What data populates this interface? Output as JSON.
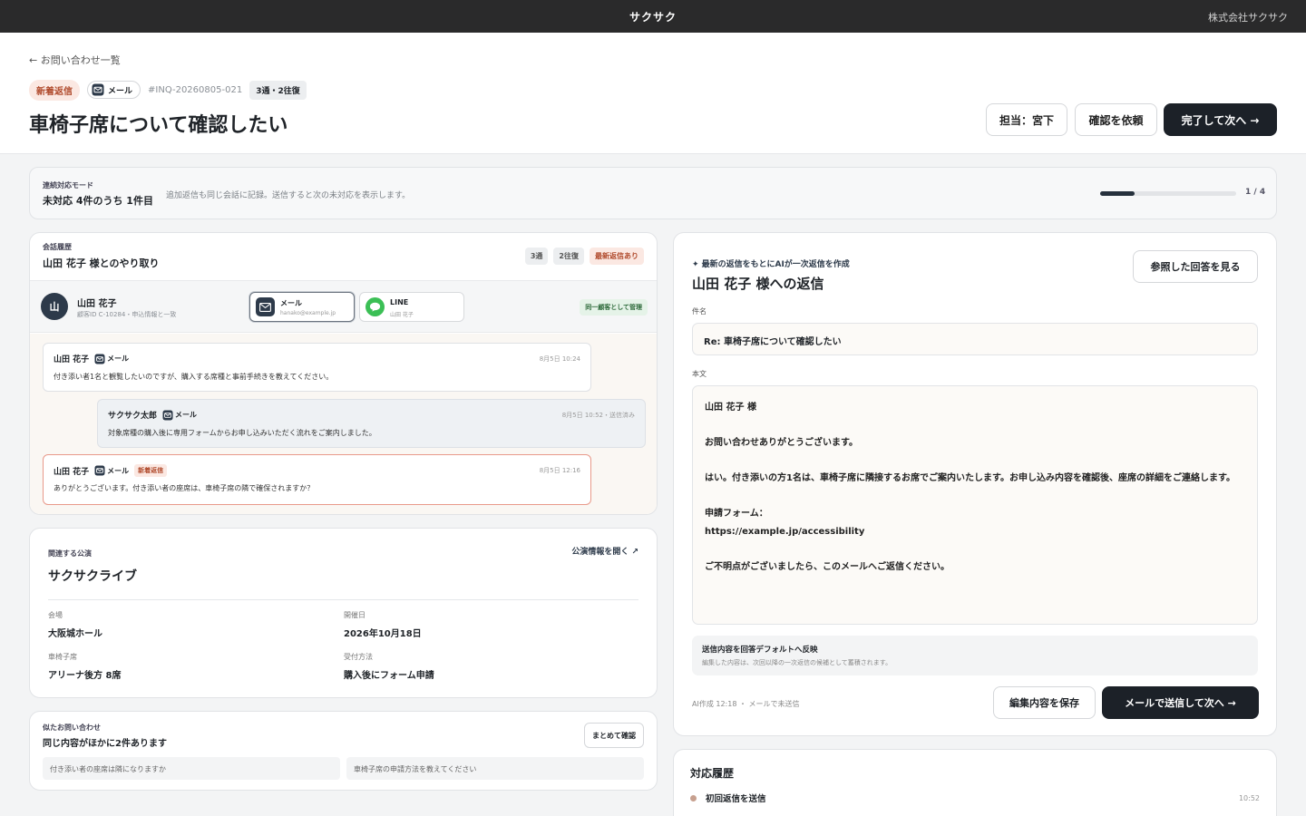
{
  "topbar": {
    "brand": "サクサク",
    "company": "株式会社サクサク"
  },
  "header": {
    "back": "← お問い合わせ一覧",
    "tag_new": "新着返信",
    "tag_channel": "メール",
    "inquiry_id": "#INQ-20260805-021",
    "thread_count": "3通・2往復",
    "title": "車椅子席について確認したい",
    "assignee_btn": "担当：宮下",
    "request_btn": "確認を依頼",
    "complete_btn": "完了して次へ →"
  },
  "mode": {
    "label": "連続対応モード",
    "value": "未対応 4件のうち 1件目",
    "description": "追加返信も同じ会話に記録。送信すると次の未対応を表示します。",
    "progress": 0.25,
    "page": "1 / 4"
  },
  "conversation": {
    "label": "会話履歴",
    "title": "山田 花子 様とのやり取り",
    "pills": [
      "3通",
      "2往復",
      "最新返信あり"
    ],
    "customer": {
      "avatar": "山",
      "name": "山田 花子",
      "sub": "顧客ID C-10284・申込情報と一致",
      "channels": [
        {
          "name": "メール",
          "sub": "hanako@example.jp"
        },
        {
          "name": "LINE",
          "sub": "山田 花子"
        }
      ],
      "same_badge": "同一顧客として管理"
    },
    "messages": [
      {
        "who": "山田 花子",
        "channel": "メール",
        "time": "8月5日 10:24",
        "body": "付き添い者1名と観覧したいのですが、購入する席種と事前手続きを教えてください。"
      },
      {
        "who": "サクサク太郎",
        "channel": "メール",
        "time": "8月5日 10:52・送信済み",
        "body": "対象席種の購入後に専用フォームからお申し込みいただく流れをご案内しました。"
      },
      {
        "who": "山田 花子",
        "channel": "メール",
        "badge": "新着返信",
        "time": "8月5日 12:16",
        "body": "ありがとうございます。付き添い者の座席は、車椅子席の隣で確保されますか？"
      }
    ]
  },
  "event": {
    "label": "関連する公演",
    "name": "サクサクライブ",
    "open_link": "公演情報を開く ↗",
    "fields": [
      {
        "k": "会場",
        "v": "大阪城ホール"
      },
      {
        "k": "開催日",
        "v": "2026年10月18日"
      },
      {
        "k": "車椅子席",
        "v": "アリーナ後方 8席"
      },
      {
        "k": "受付方法",
        "v": "購入後にフォーム申請"
      }
    ]
  },
  "similar": {
    "label": "似たお問い合わせ",
    "title": "同じ内容がほかに2件あります",
    "button": "まとめて確認",
    "items": [
      "付き添い者の座席は隣になりますか",
      "車椅子席の申請方法を教えてください"
    ]
  },
  "reply": {
    "ai_label": "✦ 最新の返信をもとにAIが一次返信を作成",
    "title": "山田 花子 様への返信",
    "ref_btn": "参照した回答を見る",
    "subject_label": "件名",
    "subject": "Re: 車椅子席について確認したい",
    "body_label": "本文",
    "body_lines": [
      "山田 花子 様",
      "",
      "お問い合わせありがとうございます。",
      "",
      "はい。付き添いの方1名は、車椅子席に隣接するお席でご案内いたします。お申し込み内容を確認後、座席の詳細をご連絡します。",
      "",
      "申請フォーム：",
      "https://example.jp/accessibility",
      "",
      "ご不明点がございましたら、このメールへご返信ください。"
    ],
    "reflect_title": "送信内容を回答デフォルトへ反映",
    "reflect_desc": "編集した内容は、次回以降の一次返信の候補として蓄積されます。",
    "meta": "AI作成 12:18 ・ メールで未送信",
    "save_btn": "編集内容を保存",
    "send_btn": "メールで送信して次へ →"
  },
  "history": {
    "title": "対応履歴",
    "items": [
      {
        "label": "初回返信を送信",
        "time": "10:52"
      }
    ]
  }
}
